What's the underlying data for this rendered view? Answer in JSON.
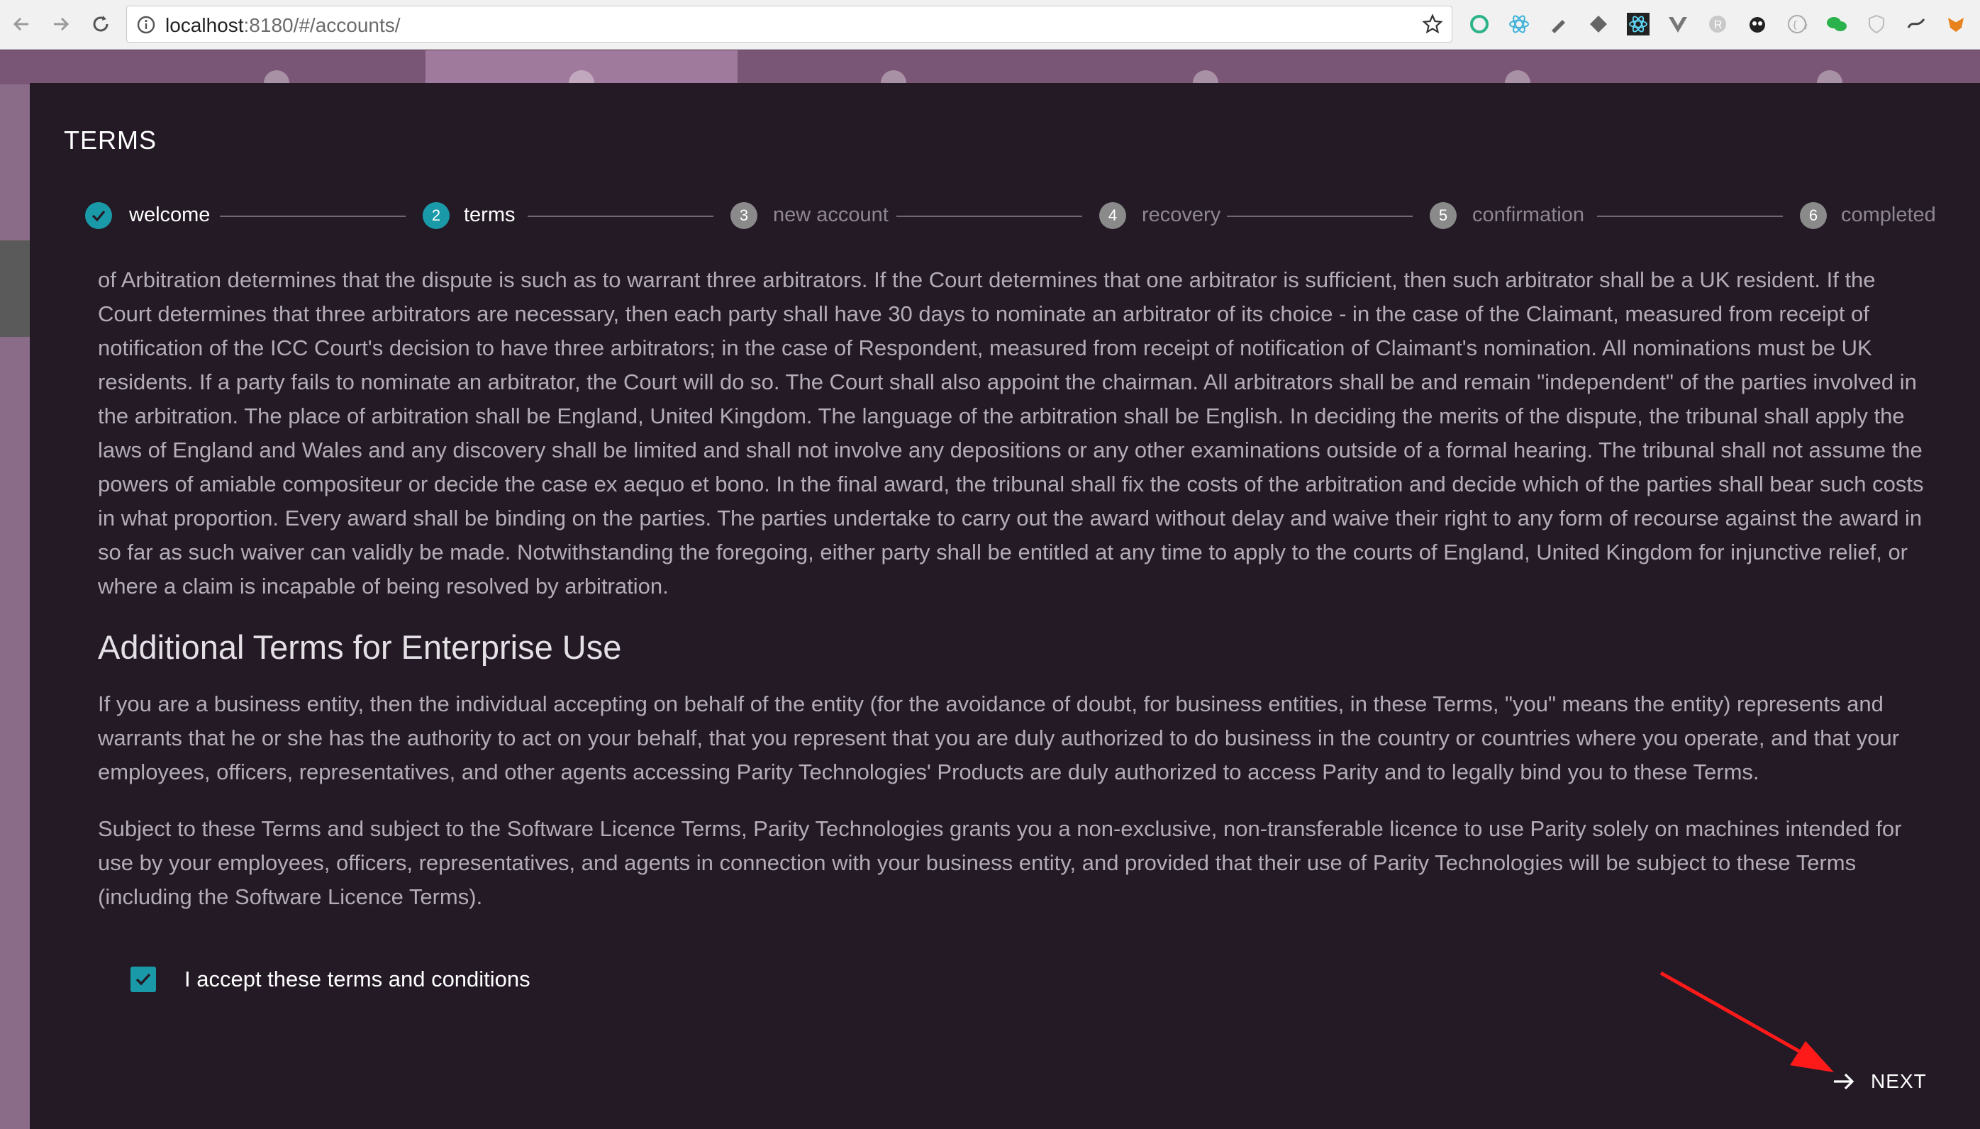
{
  "browser": {
    "url_host": "localhost",
    "url_rest": ":8180/#/accounts/"
  },
  "dialog": {
    "title": "TERMS",
    "steps": [
      {
        "num": "",
        "label": "welcome",
        "state": "done"
      },
      {
        "num": "2",
        "label": "terms",
        "state": "active"
      },
      {
        "num": "3",
        "label": "new account",
        "state": "pending"
      },
      {
        "num": "4",
        "label": "recovery",
        "state": "pending"
      },
      {
        "num": "5",
        "label": "confirmation",
        "state": "pending"
      },
      {
        "num": "6",
        "label": "completed",
        "state": "pending"
      }
    ],
    "paragraphs": {
      "arbitration": "of Arbitration determines that the dispute is such as to warrant three arbitrators. If the Court determines that one arbitrator is sufficient, then such arbitrator shall be a UK resident. If the Court determines that three arbitrators are necessary, then each party shall have 30 days to nominate an arbitrator of its choice - in the case of the Claimant, measured from receipt of notification of the ICC Court's decision to have three arbitrators; in the case of Respondent, measured from receipt of notification of Claimant's nomination. All nominations must be UK residents. If a party fails to nominate an arbitrator, the Court will do so. The Court shall also appoint the chairman. All arbitrators shall be and remain \"independent\" of the parties involved in the arbitration. The place of arbitration shall be England, United Kingdom. The language of the arbitration shall be English. In deciding the merits of the dispute, the tribunal shall apply the laws of England and Wales and any discovery shall be limited and shall not involve any depositions or any other examinations outside of a formal hearing. The tribunal shall not assume the powers of amiable compositeur or decide the case ex aequo et bono. In the final award, the tribunal shall fix the costs of the arbitration and decide which of the parties shall bear such costs in what proportion. Every award shall be binding on the parties. The parties undertake to carry out the award without delay and waive their right to any form of recourse against the award in so far as such waiver can validly be made. Notwithstanding the foregoing, either party shall be entitled at any time to apply to the courts of England, United Kingdom for injunctive relief, or where a claim is incapable of being resolved by arbitration.",
      "heading": "Additional Terms for Enterprise Use",
      "business": "If you are a business entity, then the individual accepting on behalf of the entity (for the avoidance of doubt, for business entities, in these Terms, \"you\" means the entity) represents and warrants that he or she has the authority to act on your behalf, that you represent that you are duly authorized to do business in the country or countries where you operate, and that your employees, officers, representatives, and other agents accessing Parity Technologies' Products are duly authorized to access Parity and to legally bind you to these Terms.",
      "licence": "Subject to these Terms and subject to the Software Licence Terms, Parity Technologies grants you a non-exclusive, non-transferable licence to use Parity solely on machines intended for use by your employees, officers, representatives, and agents in connection with your business entity, and provided that their use of Parity Technologies will be subject to these Terms (including the Software Licence Terms)."
    },
    "accept_label": "I accept these terms and conditions",
    "accept_checked": true,
    "next_label": "NEXT"
  },
  "colors": {
    "accent": "#1a9aa8",
    "dialog_bg": "#241a26",
    "annotation_arrow": "#ff1a1a"
  }
}
